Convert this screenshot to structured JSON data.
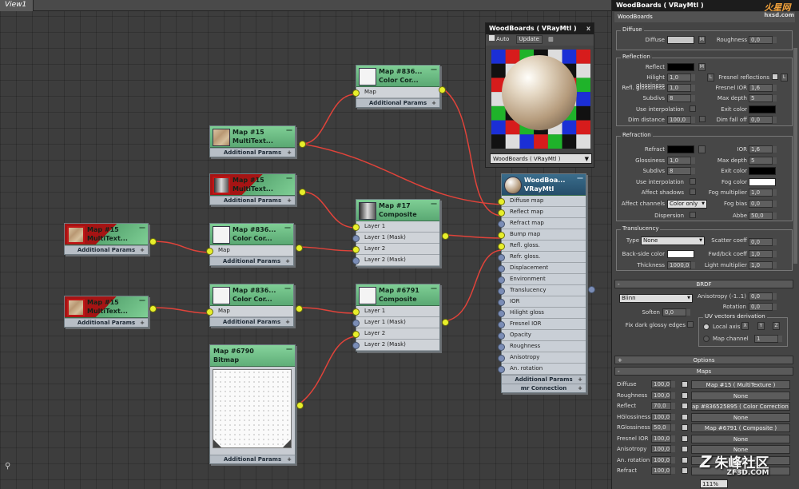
{
  "view": {
    "tab": "View1"
  },
  "nodes": {
    "color_corr_top": {
      "title1": "Map #836...",
      "title2": "Color Cor...",
      "slot": "Map",
      "ap": "Additional Params"
    },
    "multitex_top": {
      "title1": "Map #15",
      "title2": "MultiText...",
      "ap": "Additional Params"
    },
    "multitex_mid": {
      "title1": "Map #15",
      "title2": "MultiText...",
      "ap": "Additional Params"
    },
    "multitex_left1": {
      "title1": "Map #15",
      "title2": "MultiText...",
      "ap": "Additional Params"
    },
    "color_corr_mid": {
      "title1": "Map #836...",
      "title2": "Color Cor...",
      "slot": "Map",
      "ap": "Additional Params"
    },
    "multitex_left2": {
      "title1": "Map #15",
      "title2": "MultiText...",
      "ap": "Additional Params"
    },
    "color_corr_low": {
      "title1": "Map #836...",
      "title2": "Color Cor...",
      "slot": "Map",
      "ap": "Additional Params"
    },
    "composite17": {
      "title1": "Map #17",
      "title2": "Composite",
      "slots": [
        "Layer 1",
        "Layer 1 (Mask)",
        "Layer 2",
        "Layer 2 (Mask)"
      ]
    },
    "composite6791": {
      "title1": "Map #6791",
      "title2": "Composite",
      "slots": [
        "Layer 1",
        "Layer 1 (Mask)",
        "Layer 2",
        "Layer 2 (Mask)"
      ]
    },
    "bitmap": {
      "title1": "Map #6790",
      "title2": "Bitmap",
      "ap": "Additional Params"
    },
    "vray": {
      "title1": "WoodBoa...",
      "title2": "VRayMtl",
      "slots": [
        "Diffuse map",
        "Reflect map",
        "Refract map",
        "Bump map",
        "Refl. gloss.",
        "Refr. gloss.",
        "Displacement",
        "Environment",
        "Translucency",
        "IOR",
        "Hilight gloss",
        "Fresnel IOR",
        "Opacity",
        "Roughness",
        "Anisotropy",
        "An. rotation"
      ],
      "ap": "Additional Params",
      "mr": "mr Connection"
    }
  },
  "preview": {
    "title": "WoodBoards ( VRayMtl )",
    "close": "x",
    "auto": "Auto",
    "update": "Update",
    "selector": "WoodBoards ( VRayMtl )"
  },
  "panel": {
    "title": "WoodBoards ( VRayMtl )",
    "logo": "火星网",
    "logo_sub": "hxsd.com",
    "material_name": "WoodBoards",
    "diffuse": {
      "group": "Diffuse",
      "diffuse": "Diffuse",
      "m": "M",
      "roughness": "Roughness",
      "roughness_val": "0,0"
    },
    "reflection": {
      "group": "Reflection",
      "reflect": "Reflect",
      "hilight": "Hilight glossiness",
      "hilight_val": "1,0",
      "l": "L",
      "fresnel": "Fresnel reflections",
      "refl_gloss": "Refl. glossiness",
      "refl_gloss_val": "1,0",
      "fresnel_ior": "Fresnel IOR",
      "fresnel_ior_val": "1,6",
      "subdivs": "Subdivs",
      "subdivs_val": "8",
      "max_depth": "Max depth",
      "max_depth_val": "5",
      "use_interp": "Use interpolation",
      "exit_color": "Exit color",
      "dim_dist": "Dim distance",
      "dim_dist_val": "100,0",
      "dim_falloff": "Dim fall off",
      "dim_falloff_val": "0,0"
    },
    "refraction": {
      "group": "Refraction",
      "refract": "Refract",
      "ior": "IOR",
      "ior_val": "1,6",
      "glossiness": "Glossiness",
      "glossiness_val": "1,0",
      "max_depth": "Max depth",
      "max_depth_val": "5",
      "subdivs": "Subdivs",
      "subdivs_val": "8",
      "exit_color": "Exit color",
      "use_interp": "Use interpolation",
      "fog_color": "Fog color",
      "affect_shadows": "Affect shadows",
      "fog_mult": "Fog multiplier",
      "fog_mult_val": "1,0",
      "affect_channels": "Affect channels",
      "affect_channels_val": "Color only",
      "fog_bias": "Fog bias",
      "fog_bias_val": "0,0",
      "dispersion": "Dispersion",
      "abbe": "Abbe",
      "abbe_val": "50,0"
    },
    "translucency": {
      "group": "Translucency",
      "type": "Type",
      "type_val": "None",
      "scatter": "Scatter coeff",
      "scatter_val": "0,0",
      "backside": "Back-side color",
      "fwd": "Fwd/bck coeff",
      "fwd_val": "1,0",
      "thickness": "Thickness",
      "thickness_val": "1000,0",
      "light_mult": "Light multiplier",
      "light_mult_val": "1,0"
    },
    "brdf": {
      "rollout": "BRDF",
      "sign": "-",
      "type": "Blinn",
      "aniso": "Anisotropy (-1..1)",
      "aniso_val": "0,0",
      "rotation": "Rotation",
      "rotation_val": "0,0",
      "soften": "Soften",
      "soften_val": "0,0",
      "uv_group": "UV vectors derivation",
      "fix_dark": "Fix dark glossy edges",
      "local_axis": "Local axis",
      "x": "X",
      "y": "Y",
      "z": "Z",
      "map_channel": "Map channel",
      "map_channel_val": "1"
    },
    "options": {
      "rollout": "Options",
      "sign": "+"
    },
    "maps": {
      "rollout": "Maps",
      "sign": "-",
      "rows": [
        {
          "name": "Diffuse",
          "amount": "100,0",
          "map": "Map #15 ( MultiTexture )"
        },
        {
          "name": "Roughness",
          "amount": "100,0",
          "map": "None"
        },
        {
          "name": "Reflect",
          "amount": "70,0",
          "map": "ap #836525895 ( Color Correction )"
        },
        {
          "name": "HGlossiness",
          "amount": "100,0",
          "map": "None"
        },
        {
          "name": "RGlossiness",
          "amount": "50,0",
          "map": "Map #6791 ( Composite )"
        },
        {
          "name": "Fresnel IOR",
          "amount": "100,0",
          "map": "None"
        },
        {
          "name": "Anisotropy",
          "amount": "100,0",
          "map": "None"
        },
        {
          "name": "An. rotation",
          "amount": "100,0",
          "map": "None"
        },
        {
          "name": "Refract",
          "amount": "100,0",
          "map": "None"
        }
      ]
    }
  },
  "statusbar": {
    "zoom": "111%"
  },
  "watermark": {
    "text": "朱峰社区",
    "sub": "ZF3D.COM"
  },
  "colors": {
    "node_green": "#6bbd84",
    "vray_blue": "#2f5e7e",
    "wire": "#e0433a",
    "socket_on": "#e8ef2b",
    "socket_off": "#7b8db6"
  }
}
